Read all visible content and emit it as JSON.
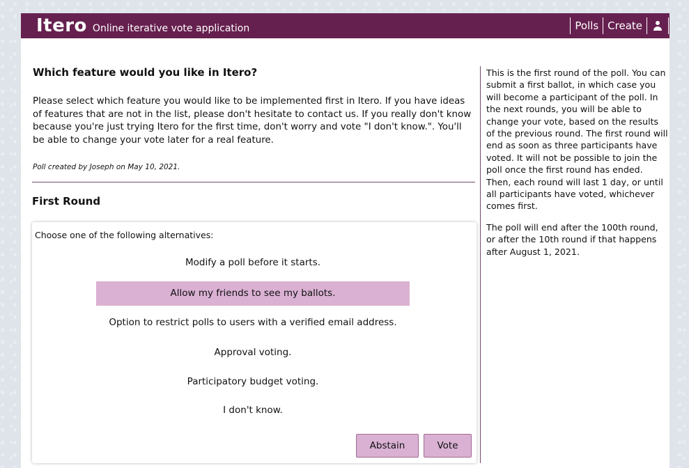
{
  "header": {
    "brand": "Itero",
    "tagline": "Online iterative vote application",
    "nav": {
      "polls": "Polls",
      "create": "Create"
    },
    "user_icon": "user-icon"
  },
  "poll": {
    "title": "Which feature would you like in Itero?",
    "description": "Please select which feature you would like to be implemented first in Itero. If you have ideas of features that are not in the list, please don't hesitate to contact us. If you really don't know because you're just trying Itero for the first time, don't worry and vote \"I don't know.\". You'll be able to change your vote later for a real feature.",
    "created_by": "Poll created by Joseph on May 10, 2021."
  },
  "round": {
    "title": "First Round",
    "prompt": "Choose one of the following alternatives:",
    "options": [
      {
        "label": "Modify a poll before it starts.",
        "selected": false
      },
      {
        "label": "Allow my friends to see my ballots.",
        "selected": true
      },
      {
        "label": "Option to restrict polls to users with a verified email address.",
        "selected": false
      },
      {
        "label": "Approval voting.",
        "selected": false
      },
      {
        "label": "Participatory budget voting.",
        "selected": false
      },
      {
        "label": "I don't know.",
        "selected": false
      }
    ],
    "buttons": {
      "abstain": "Abstain",
      "vote": "Vote"
    }
  },
  "sidebar": {
    "paragraphs": [
      "This is the first round of the poll. You can submit a first ballot, in which case you will become a participant of the poll. In the next rounds, you will be able to change your vote, based on the results of the previous round. The first round will end as soon as three participants have voted. It will not be possible to join the poll once the first round has ended. Then, each round will last 1 day, or until all participants have voted, whichever comes first.",
      "The poll will end after the 100th round, or after the 10th round if that happens after August 1, 2021."
    ]
  },
  "colors": {
    "header_bg": "#66204f",
    "selected_option": "#dab1d3",
    "divider": "#6f4a66"
  }
}
